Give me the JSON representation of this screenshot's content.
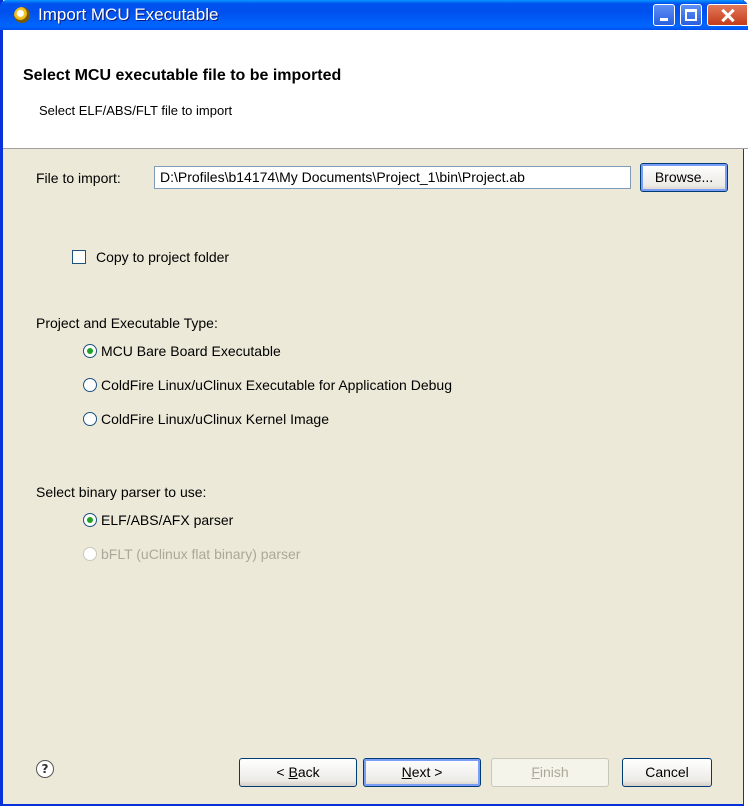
{
  "window": {
    "title": "Import MCU Executable"
  },
  "header": {
    "title": "Select MCU executable file to be imported",
    "description": "Select ELF/ABS/FLT file to import"
  },
  "file": {
    "label": "File to import:",
    "value": "D:\\Profiles\\b14174\\My Documents\\Project_1\\bin\\Project.ab",
    "browse_label": "Browse..."
  },
  "copy_option": {
    "label": "Copy to project folder",
    "checked": false
  },
  "project_type": {
    "label": "Project and Executable Type:",
    "options": [
      {
        "label": "MCU Bare Board Executable",
        "selected": true
      },
      {
        "label": "ColdFire Linux/uClinux Executable for Application Debug",
        "selected": false
      },
      {
        "label": "ColdFire Linux/uClinux Kernel Image",
        "selected": false
      }
    ]
  },
  "parser": {
    "label": "Select binary parser to use:",
    "options": [
      {
        "label": "ELF/ABS/AFX parser",
        "selected": true,
        "enabled": true
      },
      {
        "label": "bFLT (uClinux flat binary) parser",
        "selected": false,
        "enabled": false
      }
    ]
  },
  "footer": {
    "help_icon": "?",
    "back_prefix": "< ",
    "back_mnemonic": "B",
    "back_rest": "ack",
    "next_mnemonic": "N",
    "next_rest": "ext >",
    "finish_mnemonic": "F",
    "finish_rest": "inish",
    "cancel_label": "Cancel"
  }
}
